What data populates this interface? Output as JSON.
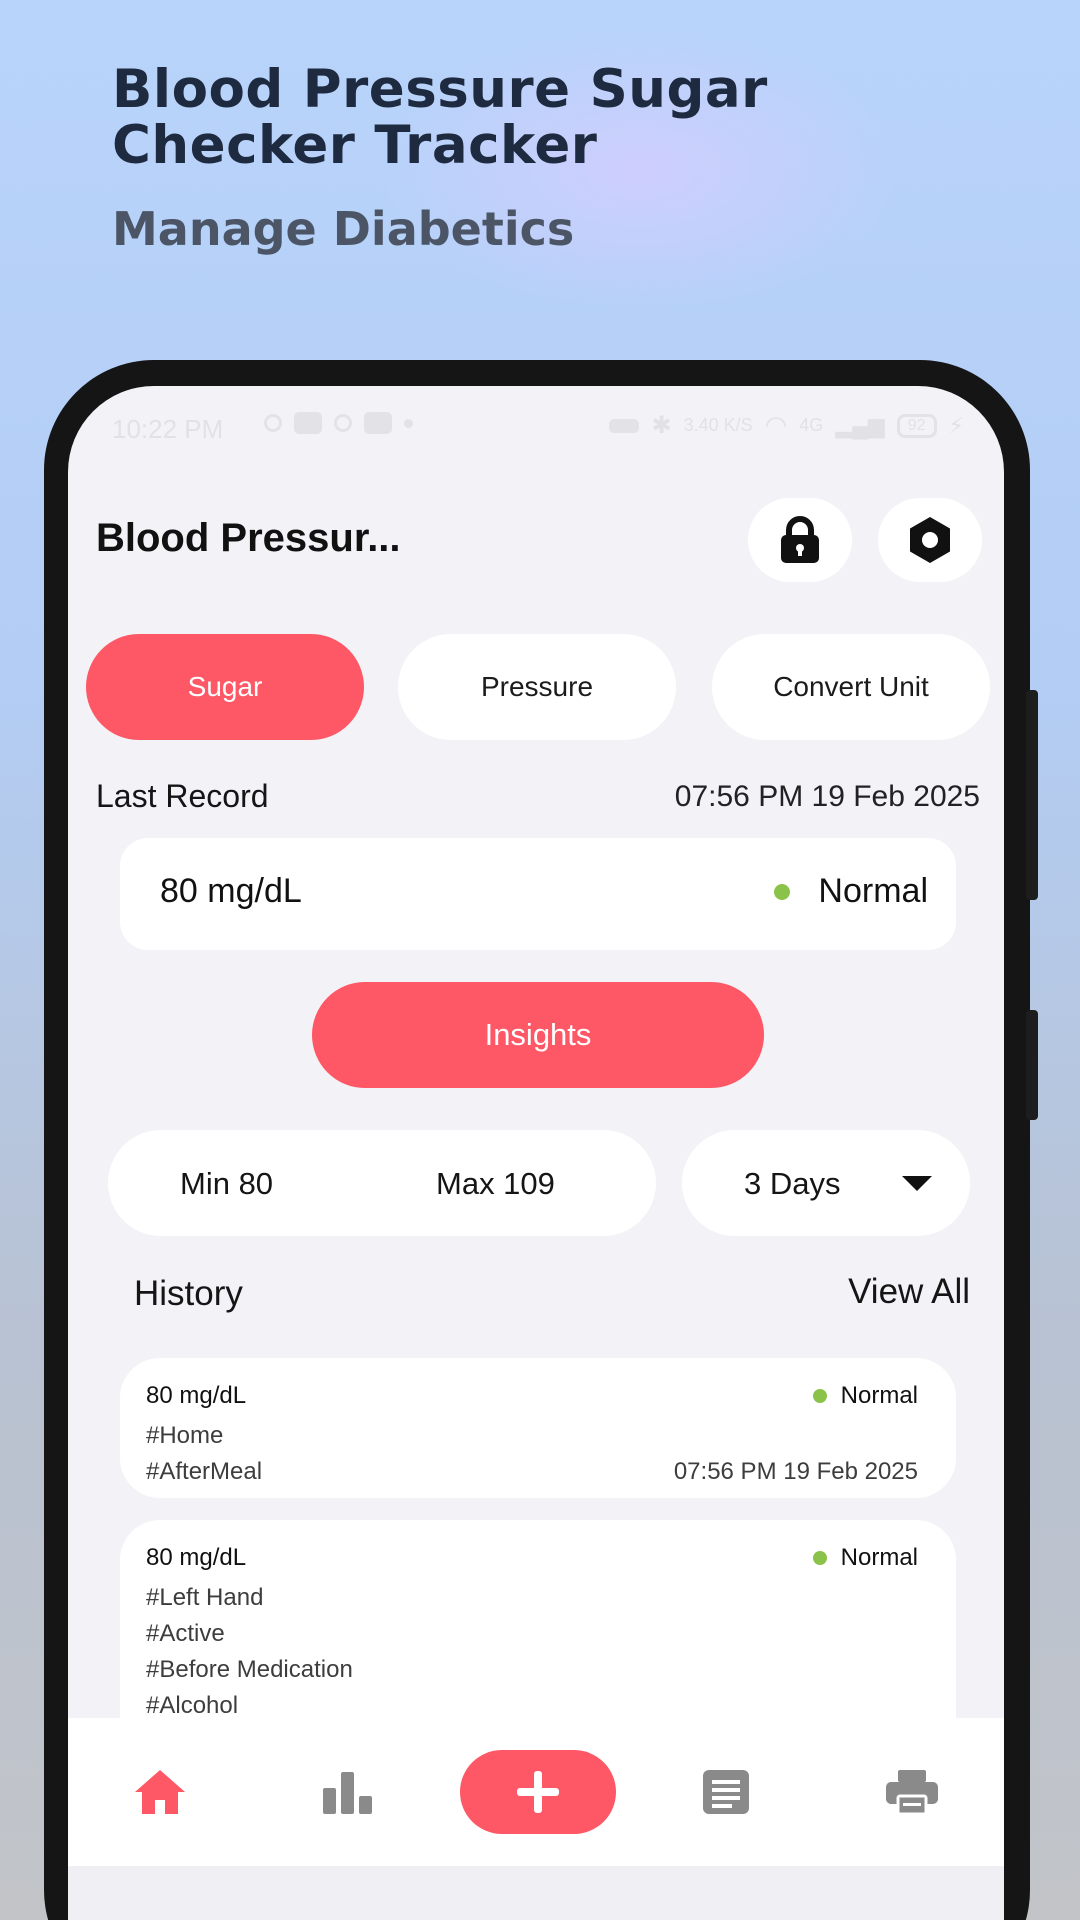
{
  "promo": {
    "title_line1": "Blood Pressure Sugar",
    "title_line2": "Checker Tracker",
    "subtitle": "Manage Diabetics"
  },
  "status_bar": {
    "time": "10:22 PM",
    "network_speed": "3.40 K/S",
    "network": "4G",
    "battery": "92"
  },
  "header": {
    "title": "Blood Pressur...",
    "lock_icon": "lock-icon",
    "settings_icon": "hexagon-settings-icon"
  },
  "tabs": [
    {
      "label": "Sugar",
      "active": true
    },
    {
      "label": "Pressure",
      "active": false
    },
    {
      "label": "Convert Unit",
      "active": false
    }
  ],
  "last_record": {
    "label": "Last Record",
    "datetime": "07:56 PM 19 Feb 2025",
    "value": "80  mg/dL",
    "status": "Normal"
  },
  "insights_label": "Insights",
  "stats": {
    "min": "Min 80",
    "max": "Max 109",
    "range": "3 Days"
  },
  "history": {
    "title": "History",
    "view_all": "View All",
    "items": [
      {
        "value": "80  mg/dL",
        "status": "Normal",
        "tags": [
          "#Home",
          "#AfterMeal"
        ],
        "datetime": "07:56 PM 19 Feb 2025"
      },
      {
        "value": "80  mg/dL",
        "status": "Normal",
        "tags": [
          "#Left Hand",
          "#Active",
          "#Before Medication",
          "#Alcohol"
        ],
        "datetime": ""
      }
    ]
  },
  "nav": {
    "items": [
      "home-icon",
      "bar-chart-icon",
      "add-icon",
      "list-icon",
      "printer-icon"
    ]
  },
  "colors": {
    "accent": "#fe5765",
    "normal": "#8bc34a",
    "background": "#f3f2f7"
  }
}
